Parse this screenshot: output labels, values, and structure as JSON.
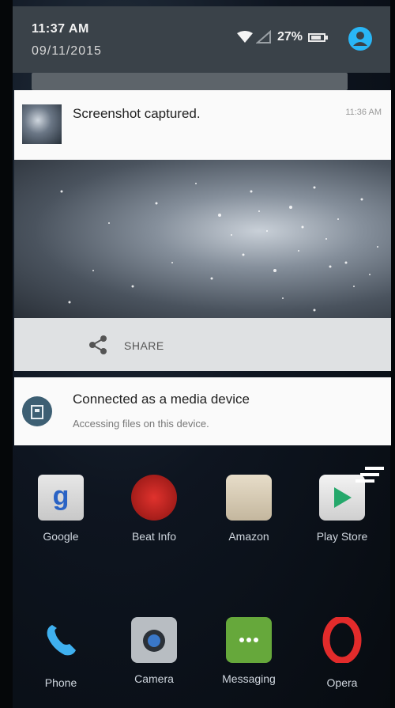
{
  "status_bar": {
    "time": "11:37 AM",
    "date": "09/11/2015",
    "battery": "27%",
    "icons": [
      "wifi-icon",
      "signal-icon",
      "battery-icon",
      "user-icon"
    ]
  },
  "notifications": [
    {
      "title": "Screenshot captured.",
      "time": "11:36 AM",
      "action_label": "SHARE",
      "action_icon": "share-icon"
    },
    {
      "title": "Connected as a media device",
      "text": "Accessing files on this device.",
      "icon": "usb-icon"
    }
  ],
  "apps": {
    "row1": [
      {
        "label": "Google",
        "icon": "google-icon"
      },
      {
        "label": "Beat Info",
        "icon": "beats-icon"
      },
      {
        "label": "Amazon",
        "icon": "amazon-icon"
      },
      {
        "label": "Play Store",
        "icon": "play-store-icon"
      }
    ],
    "row2": [
      {
        "label": "Phone",
        "icon": "phone-icon"
      },
      {
        "label": "Camera",
        "icon": "camera-icon"
      },
      {
        "label": "Messaging",
        "icon": "messaging-icon"
      },
      {
        "label": "Opera",
        "icon": "opera-icon"
      }
    ]
  },
  "colors": {
    "accent": "#29b6f6",
    "notification_bg": "#fafafa",
    "status_bar_bg": "#3a4249"
  }
}
